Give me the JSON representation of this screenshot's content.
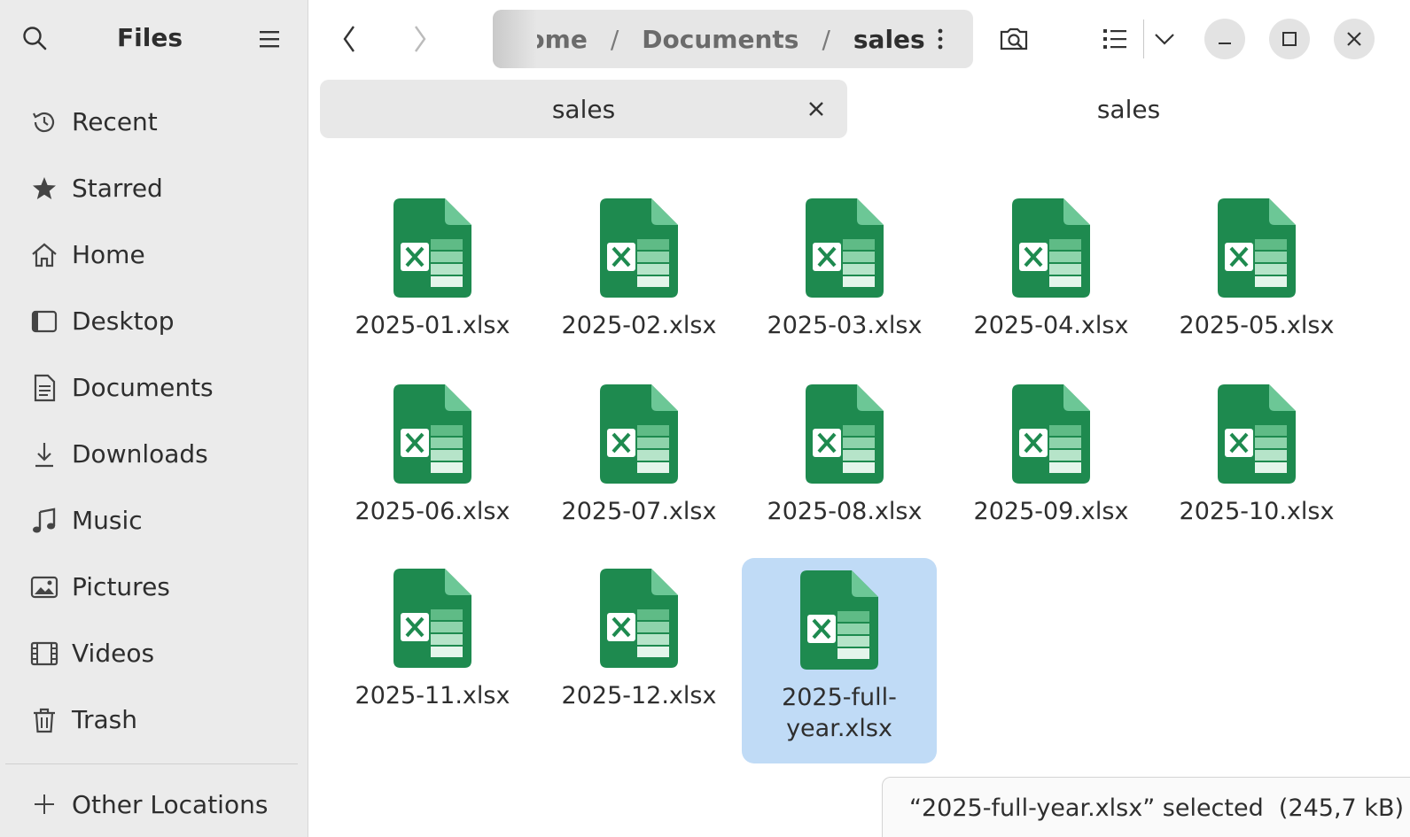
{
  "app": {
    "title": "Files"
  },
  "sidebar": {
    "items": [
      {
        "label": "Recent",
        "icon": "clock-icon"
      },
      {
        "label": "Starred",
        "icon": "star-icon"
      },
      {
        "label": "Home",
        "icon": "home-icon"
      },
      {
        "label": "Desktop",
        "icon": "desktop-icon"
      },
      {
        "label": "Documents",
        "icon": "document-icon"
      },
      {
        "label": "Downloads",
        "icon": "download-icon"
      },
      {
        "label": "Music",
        "icon": "music-icon"
      },
      {
        "label": "Pictures",
        "icon": "pictures-icon"
      },
      {
        "label": "Videos",
        "icon": "video-icon"
      },
      {
        "label": "Trash",
        "icon": "trash-icon"
      }
    ],
    "other_locations": "Other Locations"
  },
  "breadcrumb": {
    "items": [
      "Home",
      "Documents",
      "sales"
    ],
    "separator": "/"
  },
  "tabs": [
    {
      "label": "sales",
      "active": true
    },
    {
      "label": "sales",
      "active": false
    }
  ],
  "files": [
    {
      "name": "2025-01.xlsx",
      "selected": false
    },
    {
      "name": "2025-02.xlsx",
      "selected": false
    },
    {
      "name": "2025-03.xlsx",
      "selected": false
    },
    {
      "name": "2025-04.xlsx",
      "selected": false
    },
    {
      "name": "2025-05.xlsx",
      "selected": false
    },
    {
      "name": "2025-06.xlsx",
      "selected": false
    },
    {
      "name": "2025-07.xlsx",
      "selected": false
    },
    {
      "name": "2025-08.xlsx",
      "selected": false
    },
    {
      "name": "2025-09.xlsx",
      "selected": false
    },
    {
      "name": "2025-10.xlsx",
      "selected": false
    },
    {
      "name": "2025-11.xlsx",
      "selected": false
    },
    {
      "name": "2025-12.xlsx",
      "selected": false
    },
    {
      "name": "2025-full-year.xlsx",
      "selected": true
    }
  ],
  "status": {
    "text": "“2025-full-year.xlsx” selected  (245,7 kB)"
  },
  "colors": {
    "selection": "#c0dbf6",
    "excel_green": "#1f8f52",
    "sidebar_bg": "#ebebeb"
  }
}
